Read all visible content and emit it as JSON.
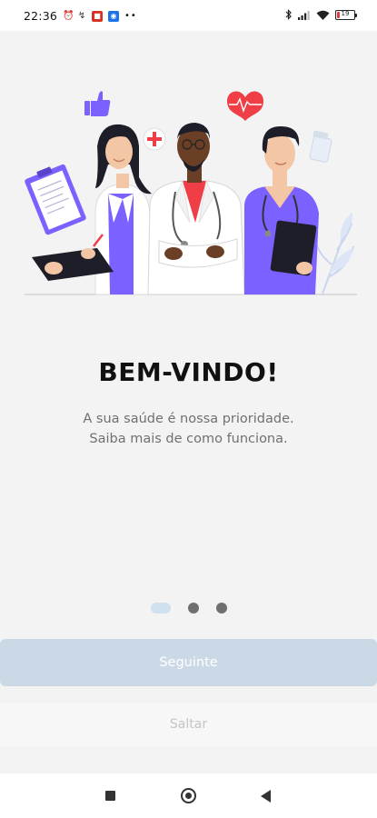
{
  "status_bar": {
    "time": "22:36",
    "battery_text": "19",
    "battery_level": 0.19
  },
  "onboarding": {
    "title": "BEM-VINDO!",
    "subtitle_line1": "A sua saúde é nossa prioridade.",
    "subtitle_line2": "Saiba mais de como funciona."
  },
  "pager": {
    "total_pages": 3,
    "active_page": 1
  },
  "actions": {
    "next_label": "Seguinte",
    "skip_label": "Saltar"
  },
  "colors": {
    "accent": "#7b61ff",
    "primary_button": "#cad9e5",
    "heart": "#ef3e45"
  }
}
